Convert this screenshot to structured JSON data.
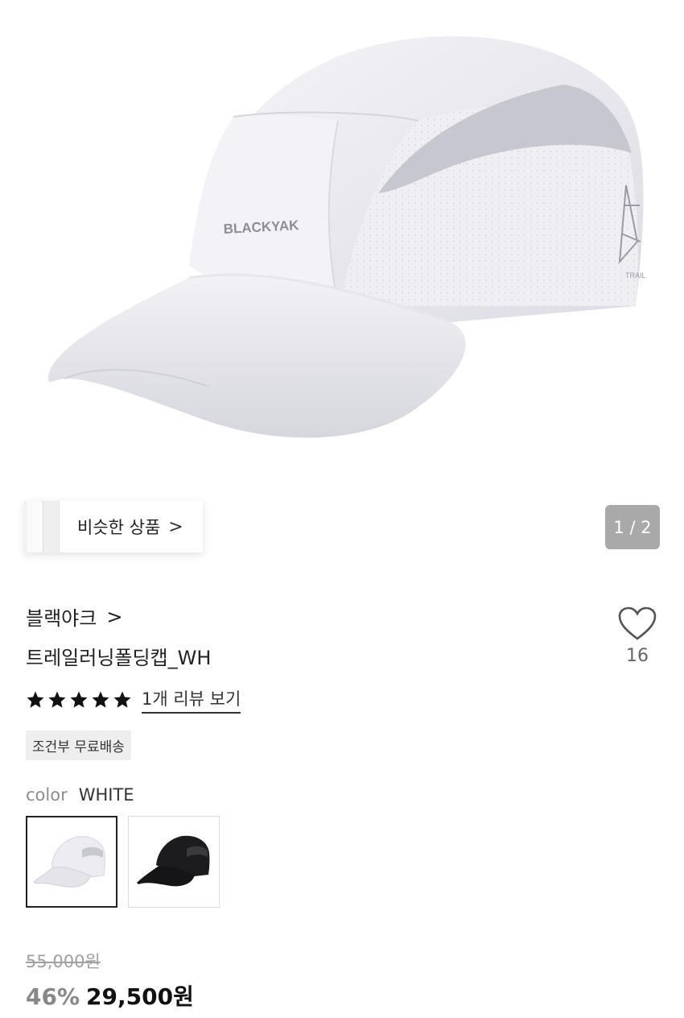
{
  "product_image": {
    "brand_logo_text": "BLACKYAK",
    "side_logo_text": "TRAIL",
    "icon": "cap-product-image"
  },
  "similar_products": {
    "label": "비슷한 상품",
    "chevron": ">"
  },
  "image_pager": {
    "text": "1 / 2"
  },
  "brand": {
    "name": "블랙야크",
    "chevron": ">"
  },
  "product": {
    "title": "트레일러닝폴딩캡_WH"
  },
  "wishlist": {
    "icon": "heart-icon",
    "count": "16"
  },
  "rating": {
    "stars": 5,
    "review_link": "1개 리뷰 보기"
  },
  "shipping_badge": "조건부 무료배송",
  "color": {
    "label": "color",
    "selected": "WHITE",
    "options": [
      "white-cap-swatch",
      "black-cap-swatch"
    ]
  },
  "pricing": {
    "original": "55,000원",
    "discount": "46%",
    "final": "29,500원"
  },
  "colors": {
    "pager_bg": "#a9a9a9",
    "discount_text": "#888888",
    "price_text": "#111111"
  }
}
